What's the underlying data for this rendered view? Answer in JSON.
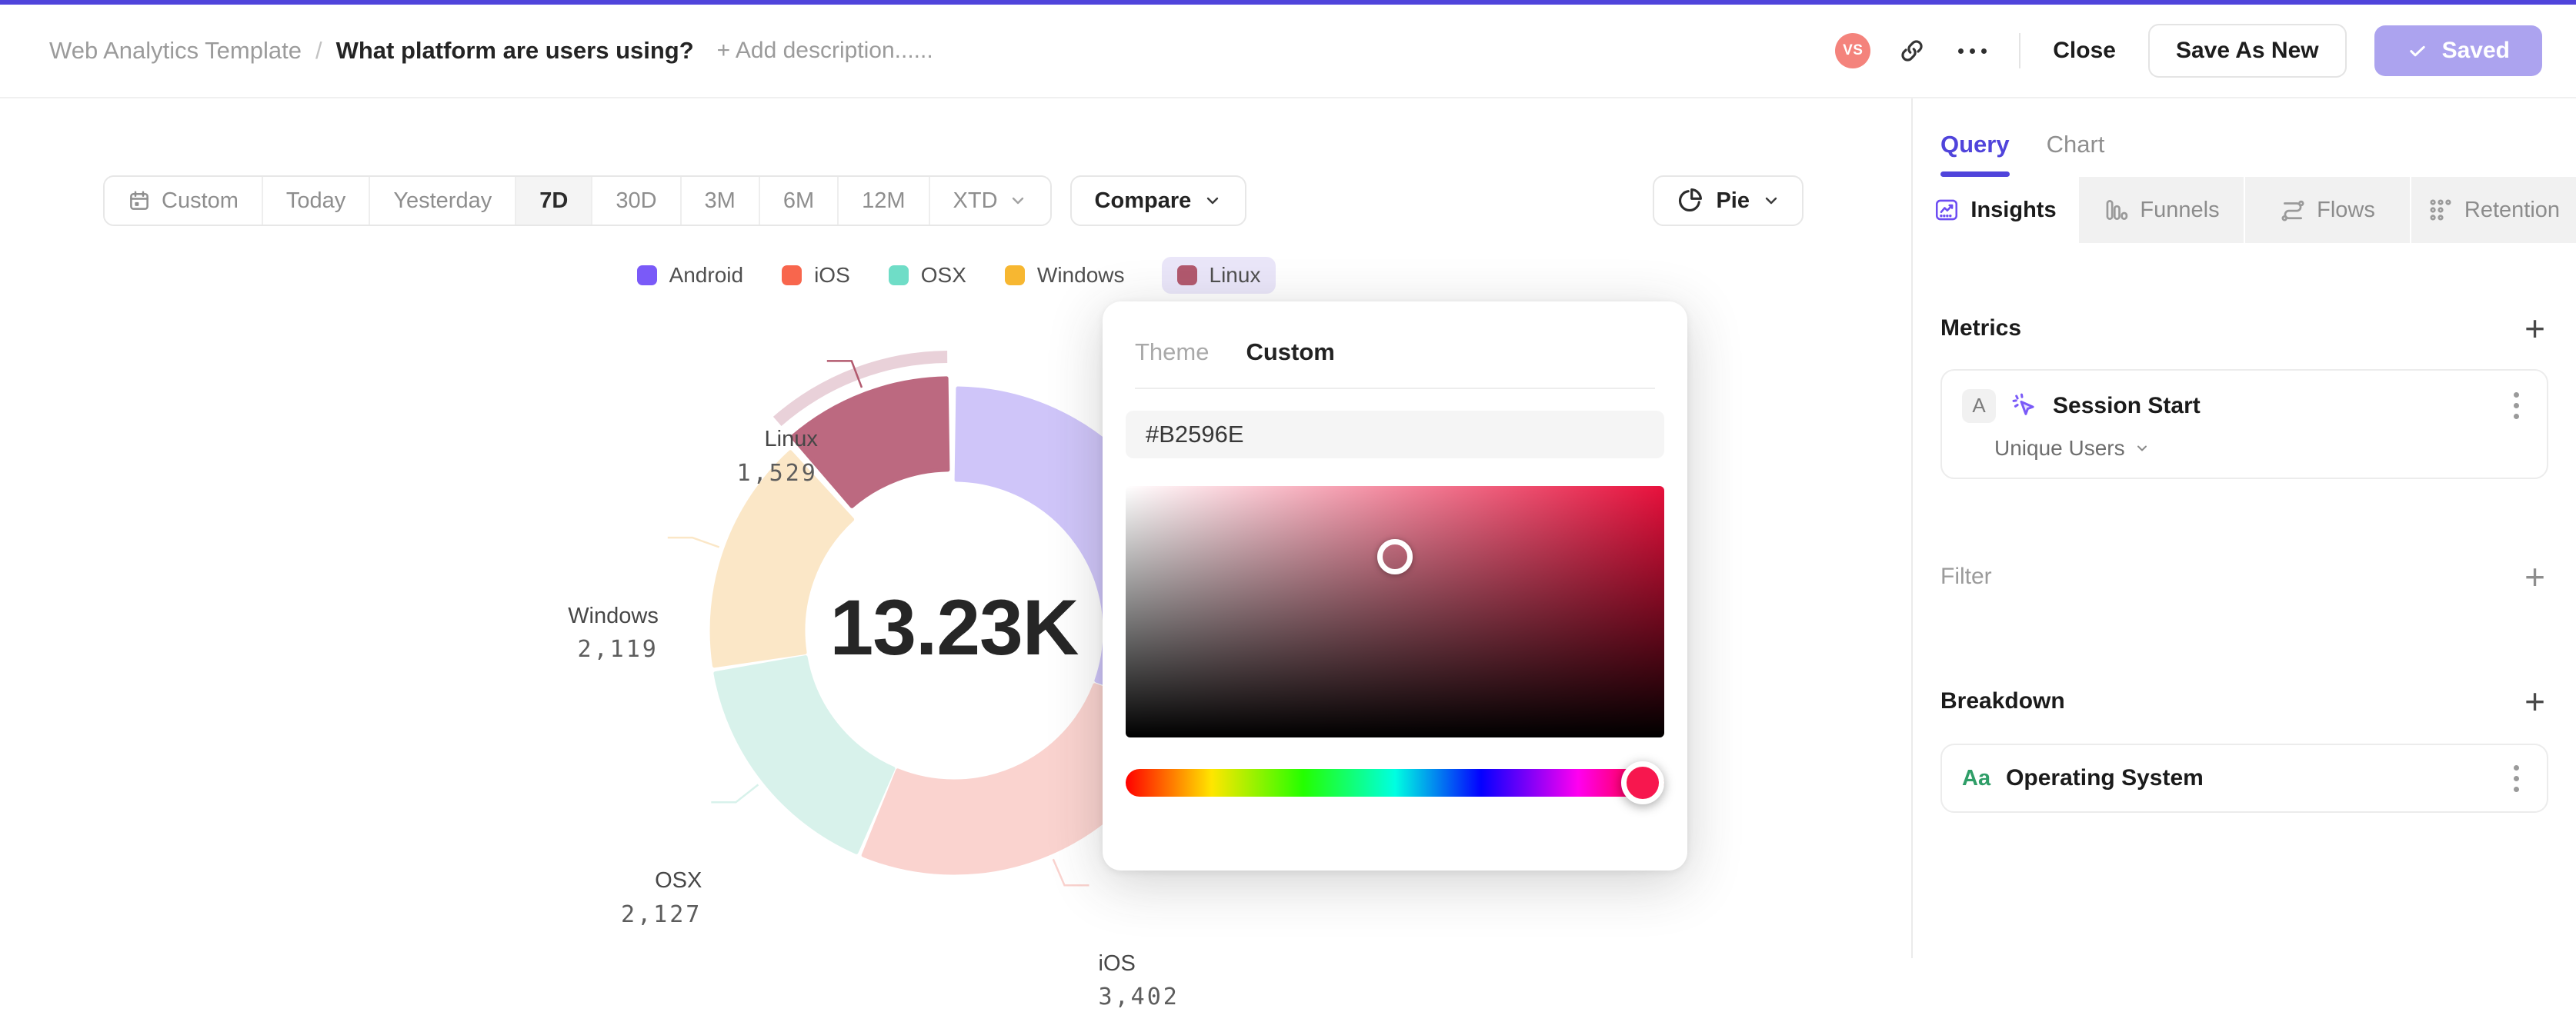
{
  "colors": {
    "accent": "#5044DB",
    "saved_button_bg": "#ACA3EF",
    "avatar_bg": "#F4837C",
    "linux_highlight": "#E9D1D9",
    "picker_gradient_right": "#E8103C",
    "hue_handle": "#F7174E",
    "legend_selected_pill_bg": "#EAE6F9"
  },
  "header": {
    "breadcrumb_parent": "Web Analytics Template",
    "breadcrumb_separator": "/",
    "title": "What platform are users using?",
    "add_description_label": "+ Add description......",
    "avatar_initials": "VS",
    "close_label": "Close",
    "save_as_new_label": "Save As New",
    "saved_label": "Saved"
  },
  "toolbar": {
    "ranges": [
      "Custom",
      "Today",
      "Yesterday",
      "7D",
      "30D",
      "3M",
      "6M",
      "12M",
      "XTD"
    ],
    "selected_range": "7D",
    "ranges_with_calendar_icon": [
      "Custom"
    ],
    "ranges_with_chevron": [
      "XTD"
    ],
    "compare_label": "Compare",
    "chart_type_label": "Pie"
  },
  "chart_data": {
    "type": "donut",
    "center_total": "13.23K",
    "total_value": 13230,
    "legend_position": "top",
    "series": [
      {
        "name": "Android",
        "value": 4053,
        "value_label": null,
        "legend_color": "#7A5AF8",
        "slice_color": "#CFC5F9",
        "selected": false
      },
      {
        "name": "iOS",
        "value": 3402,
        "value_label": "3,402",
        "legend_color": "#F8664D",
        "slice_color": "#FAD3CF",
        "selected": false
      },
      {
        "name": "OSX",
        "value": 2127,
        "value_label": "2,127",
        "legend_color": "#6FDDC7",
        "slice_color": "#D8F2EB",
        "selected": false
      },
      {
        "name": "Windows",
        "value": 2119,
        "value_label": "2,119",
        "legend_color": "#F7B731",
        "slice_color": "#FBE7C7",
        "selected": false
      },
      {
        "name": "Linux",
        "value": 1529,
        "value_label": "1,529",
        "legend_color": "#B2596E",
        "slice_color": "#BC6980",
        "selected": true
      }
    ]
  },
  "color_picker": {
    "tabs": [
      "Theme",
      "Custom"
    ],
    "active_tab": "Custom",
    "hex_value": "#B2596E",
    "sat_handle": {
      "x_pct": 50,
      "y_pct": 28
    },
    "hue_pct": 96
  },
  "sidebar": {
    "tabs": [
      {
        "label": "Query"
      },
      {
        "label": "Chart"
      }
    ],
    "active_tab": "Query",
    "view_tabs": [
      {
        "label": "Insights",
        "icon": "insights-icon",
        "active": true
      },
      {
        "label": "Funnels",
        "icon": "funnels-icon",
        "active": false
      },
      {
        "label": "Flows",
        "icon": "flows-icon",
        "active": false
      },
      {
        "label": "Retention",
        "icon": "retention-icon",
        "active": false
      }
    ],
    "add_label": "+",
    "metrics": {
      "heading": "Metrics",
      "card": {
        "badge": "A",
        "icon": "event-sparkle-icon",
        "title": "Session Start",
        "measure_label": "Unique Users"
      }
    },
    "filter": {
      "heading": "Filter"
    },
    "breakdown": {
      "heading": "Breakdown",
      "card": {
        "icon_label": "Aa",
        "title": "Operating System"
      }
    }
  },
  "icons": {
    "share": "link-icon",
    "more": "ellipsis-icon",
    "saved_check": "check-icon",
    "range_calendar": "calendar-icon",
    "chart_type": "pie-chart-icon",
    "dropdowns": "chevron-down-icon",
    "card_menu": "kebab-menu-icon"
  }
}
